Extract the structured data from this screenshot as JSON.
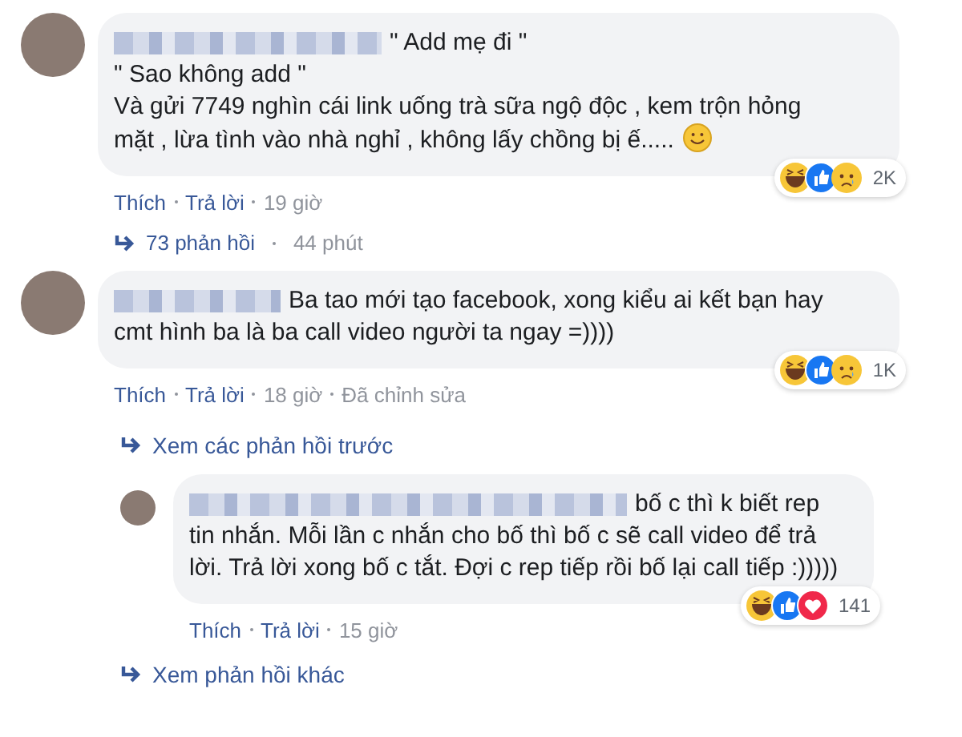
{
  "comments": [
    {
      "paragraphs": [
        "\" Add mẹ đi \"",
        "\" Sao không add \"",
        "Và gửi 7749 nghìn cái link uống trà sữa ngộ độc , kem trộn hỏng mặt , lừa tình vào nhà nghỉ , không lấy chồng bị ế....."
      ],
      "emoji_end": true,
      "actions": [
        "Thích",
        "Trả lời"
      ],
      "time": "19 giờ",
      "reactions": [
        {
          "kind": "haha"
        },
        {
          "kind": "like"
        },
        {
          "kind": "sad"
        }
      ],
      "reaction_count": "2K",
      "replies_link": {
        "text": "73 phản hồi",
        "time": "44 phút"
      }
    },
    {
      "paragraphs": [
        "Ba tao mới tạo facebook, xong kiểu ai kết bạn hay cmt hình ba là ba call video người ta ngay =))))"
      ],
      "emoji_end": false,
      "actions": [
        "Thích",
        "Trả lời"
      ],
      "time": "18 giờ",
      "edited": "Đã chỉnh sửa",
      "reactions": [
        {
          "kind": "haha"
        },
        {
          "kind": "like"
        },
        {
          "kind": "sad"
        }
      ],
      "reaction_count": "1K",
      "previous_link": "Xem các phản hồi trước",
      "replies": [
        {
          "paragraphs": [
            "bố c thì k biết rep tin nhắn. Mỗi lần c nhắn cho bố thì bố c sẽ call video để trả lời. Trả lời xong bố c tắt. Đợi c rep tiếp rồi bố lại call tiếp :)))))"
          ],
          "emoji_end": false,
          "actions": [
            "Thích",
            "Trả lời"
          ],
          "time": "15 giờ",
          "reactions": [
            {
              "kind": "haha"
            },
            {
              "kind": "like"
            },
            {
              "kind": "love"
            }
          ],
          "reaction_count": "141"
        }
      ],
      "more_link": "Xem phản hồi khác"
    }
  ]
}
